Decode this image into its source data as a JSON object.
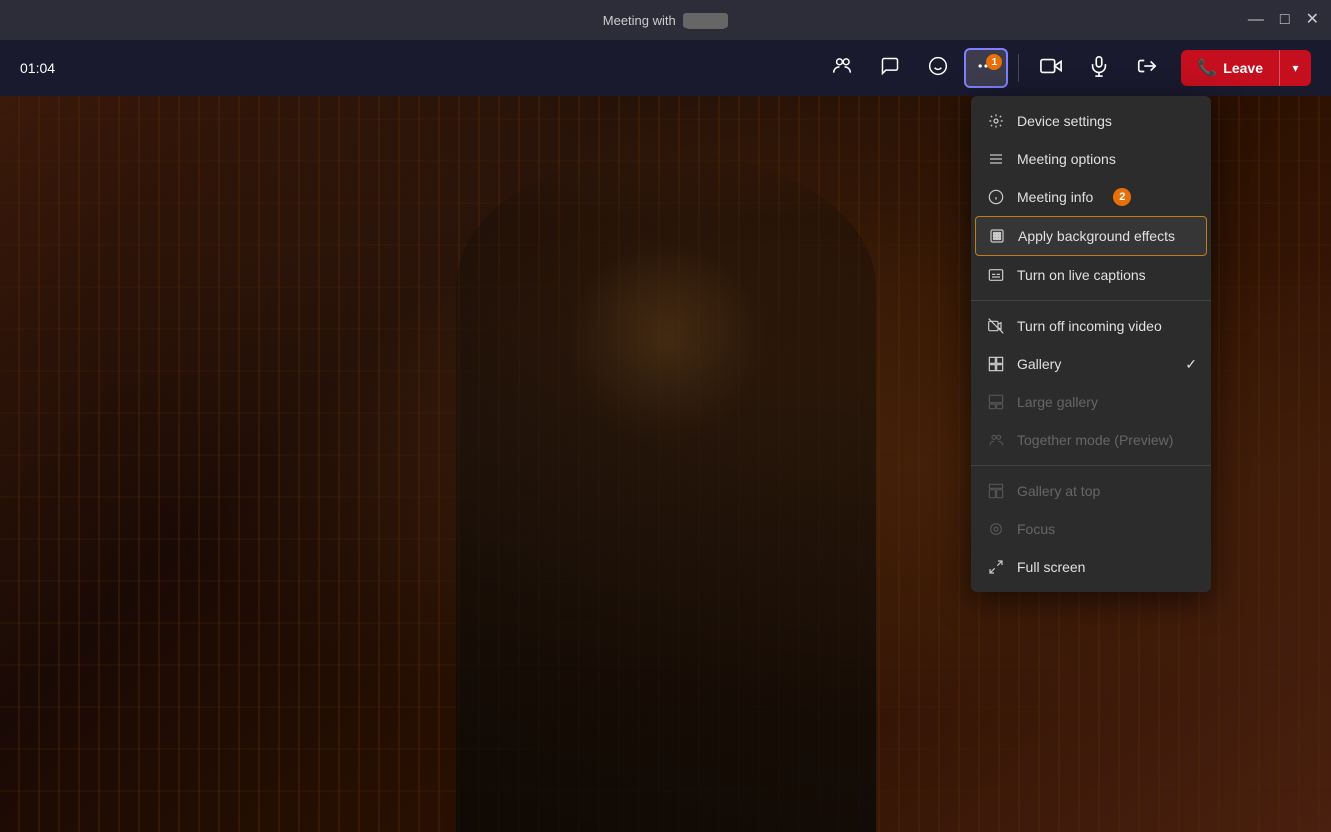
{
  "titleBar": {
    "title": "Meeting with",
    "titleBlurred": "████",
    "minBtn": "—",
    "maxBtn": "□",
    "closeBtn": "✕"
  },
  "toolbar": {
    "timer": "01:04",
    "badges": {
      "more": "1"
    },
    "leaveLabel": "Leave"
  },
  "menu": {
    "items": [
      {
        "id": "device-settings",
        "label": "Device settings",
        "icon": "gear",
        "disabled": false,
        "badge": null,
        "checked": false,
        "highlighted": false
      },
      {
        "id": "meeting-options",
        "label": "Meeting options",
        "icon": "options",
        "disabled": false,
        "badge": null,
        "checked": false,
        "highlighted": false
      },
      {
        "id": "meeting-info",
        "label": "Meeting info",
        "icon": "info",
        "disabled": false,
        "badge": "2",
        "checked": false,
        "highlighted": false
      },
      {
        "id": "apply-bg",
        "label": "Apply background effects",
        "icon": "blur",
        "disabled": false,
        "badge": null,
        "checked": false,
        "highlighted": true
      },
      {
        "id": "live-captions",
        "label": "Turn on live captions",
        "icon": "caption",
        "disabled": false,
        "badge": null,
        "checked": false,
        "highlighted": false
      },
      {
        "divider": true
      },
      {
        "id": "turn-off-video",
        "label": "Turn off incoming video",
        "icon": "video-off",
        "disabled": false,
        "badge": null,
        "checked": false,
        "highlighted": false
      },
      {
        "id": "gallery",
        "label": "Gallery",
        "icon": "gallery",
        "disabled": false,
        "badge": null,
        "checked": true,
        "highlighted": false
      },
      {
        "id": "large-gallery",
        "label": "Large gallery",
        "icon": "gallery-large",
        "disabled": true,
        "badge": null,
        "checked": false,
        "highlighted": false
      },
      {
        "id": "together-mode",
        "label": "Together mode (Preview)",
        "icon": "together",
        "disabled": true,
        "badge": null,
        "checked": false,
        "highlighted": false
      },
      {
        "divider": true
      },
      {
        "id": "gallery-at-top",
        "label": "Gallery at top",
        "icon": "gallery-top",
        "disabled": true,
        "badge": null,
        "checked": false,
        "highlighted": false
      },
      {
        "id": "focus",
        "label": "Focus",
        "icon": "focus",
        "disabled": true,
        "badge": null,
        "checked": false,
        "highlighted": false
      },
      {
        "id": "full-screen",
        "label": "Full screen",
        "icon": "fullscreen",
        "disabled": false,
        "badge": null,
        "checked": false,
        "highlighted": false
      }
    ]
  },
  "colors": {
    "accent": "#5b5fc7",
    "leave": "#c50f1f",
    "badge": "#e8700a",
    "highlight": "#c47b1a"
  }
}
